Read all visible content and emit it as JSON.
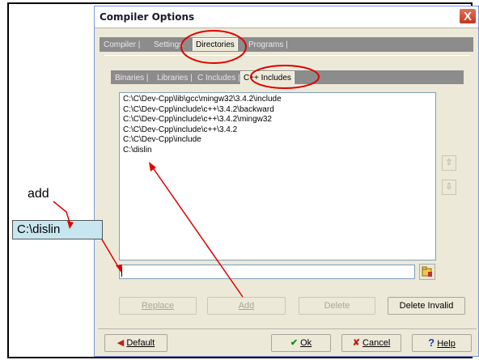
{
  "window": {
    "title": "Compiler Options",
    "close_glyph": "X"
  },
  "top_tabs": [
    {
      "label": "Compiler"
    },
    {
      "label": "Settings"
    },
    {
      "label": "Directories",
      "active": true
    },
    {
      "label": "Programs"
    }
  ],
  "sub_tabs": [
    {
      "label": "Binaries"
    },
    {
      "label": "Libraries"
    },
    {
      "label": "C Includes"
    },
    {
      "label": "C++ Includes",
      "active": true
    }
  ],
  "include_paths": [
    "C:\\C\\Dev-Cpp\\lib\\gcc\\mingw32\\3.4.2\\include",
    "C:\\C\\Dev-Cpp\\include\\c++\\3.4.2\\backward",
    "C:\\C\\Dev-Cpp\\include\\c++\\3.4.2\\mingw32",
    "C:\\C\\Dev-Cpp\\include\\c++\\3.4.2",
    "C:\\C\\Dev-Cpp\\include",
    "C:\\dislin"
  ],
  "path_input": {
    "value": ""
  },
  "action_buttons": {
    "replace": "Replace",
    "add": "Add",
    "delete": "Delete",
    "delete_invalid": "Delete Invalid"
  },
  "footer_buttons": {
    "default": "Default",
    "ok": "Ok",
    "cancel": "Cancel",
    "help": "Help"
  },
  "annotations": {
    "add_label": "add",
    "path_hint": "C:\\dislin",
    "highlight_color": "#e00000"
  }
}
